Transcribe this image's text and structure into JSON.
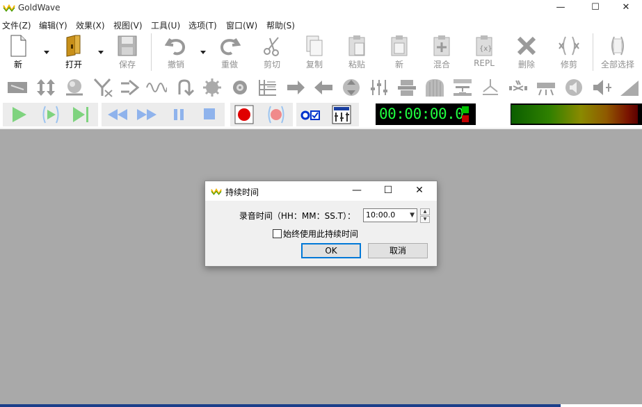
{
  "window": {
    "title": "GoldWave",
    "controls": [
      "—",
      "☐",
      "✕"
    ]
  },
  "menu": [
    "文件(Z)",
    "编辑(Y)",
    "效果(X)",
    "视图(V)",
    "工具(U)",
    "选项(T)",
    "窗口(W)",
    "帮助(S)"
  ],
  "toolbar": {
    "buttons": [
      {
        "label": "新",
        "icon": "new-file-icon",
        "enabled": true
      },
      {
        "label": "打开",
        "icon": "open-folder-icon",
        "enabled": true
      },
      {
        "label": "保存",
        "icon": "save-disk-icon",
        "enabled": false
      },
      {
        "label": "撤销",
        "icon": "undo-icon",
        "enabled": false
      },
      {
        "label": "重做",
        "icon": "redo-icon",
        "enabled": false
      },
      {
        "label": "剪切",
        "icon": "scissors-icon",
        "enabled": false
      },
      {
        "label": "复制",
        "icon": "copy-icon",
        "enabled": false
      },
      {
        "label": "粘贴",
        "icon": "paste-icon",
        "enabled": false
      },
      {
        "label": "新",
        "icon": "paste-new-icon",
        "enabled": false
      },
      {
        "label": "混合",
        "icon": "mix-icon",
        "enabled": false
      },
      {
        "label": "REPL",
        "icon": "replace-icon",
        "enabled": false
      },
      {
        "label": "删除",
        "icon": "delete-icon",
        "enabled": false
      },
      {
        "label": "修剪",
        "icon": "trim-icon",
        "enabled": false
      },
      {
        "label": "全部选择",
        "icon": "select-all-icon",
        "enabled": false
      }
    ]
  },
  "effects_toolbar": {
    "icons": [
      "mute-icon",
      "resize-icon",
      "doppler-icon",
      "crossfade-icon",
      "arrow-merge-icon",
      "wave-icon",
      "flip-icon",
      "gear-icon",
      "gear-icon",
      "spectrum-icon",
      "pan-icon",
      "reverse-arrow-icon",
      "compress-icon",
      "equalizer-icon",
      "fade-icon",
      "tunnel-icon",
      "keyboard-icon",
      "spark-icon",
      "noise-icon",
      "mechanical-icon",
      "volume-icon",
      "volume-change-icon",
      "ramp-icon"
    ]
  },
  "transport": {
    "play_icons": [
      "play-icon",
      "play-selection-icon",
      "play-to-end-icon"
    ],
    "seek_icons": [
      "rewind-icon",
      "fast-forward-icon",
      "pause-icon",
      "stop-icon"
    ],
    "record_icons": [
      "record-icon",
      "record-selection-icon"
    ],
    "misc_icons": [
      "record-options-icon",
      "control-properties-icon"
    ]
  },
  "timer": {
    "value": "00:00:00.0"
  },
  "dialog": {
    "title": "持续时间",
    "controls": [
      "—",
      "☐",
      "✕"
    ],
    "field_label": "录音时间（HH：MM：SS.T）：",
    "field_value": "10:00.0",
    "checkbox_label": "始终使用此持续时间",
    "checkbox_checked": false,
    "ok_label": "OK",
    "cancel_label": "取消"
  },
  "colors": {
    "timer_digits": "#20ff40",
    "meter_start": "#0b5e00",
    "meter_end": "#5a0000",
    "ok_focus_border": "#0078d7",
    "workspace": "#a9a9a9"
  }
}
